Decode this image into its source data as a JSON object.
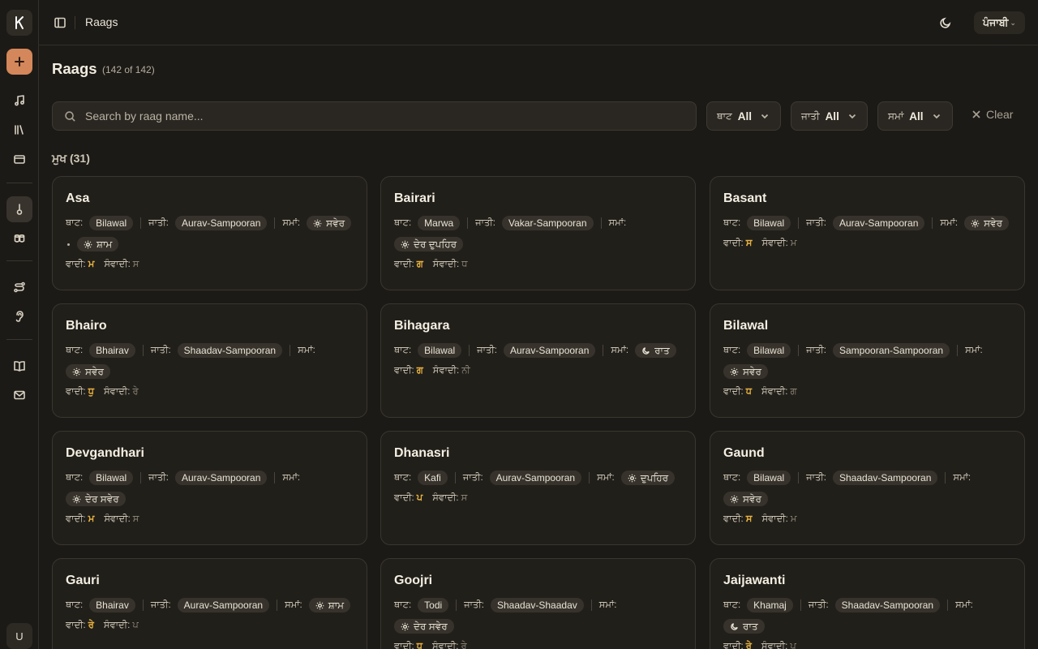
{
  "app": {
    "logo_letter": "K",
    "avatar_letter": "U"
  },
  "header": {
    "breadcrumb": "Raags",
    "language": "ਪੰਜਾਬੀ"
  },
  "page": {
    "title": "Raags",
    "count": "(142 of 142)"
  },
  "search": {
    "placeholder": "Search by raag name..."
  },
  "filters": [
    {
      "label": "ਥਾਟ",
      "value": "All"
    },
    {
      "label": "ਜਾਤੀ",
      "value": "All"
    },
    {
      "label": "ਸਮਾਂ",
      "value": "All"
    }
  ],
  "clear_label": "Clear",
  "section": {
    "label": "ਮੁਖ (31)"
  },
  "field_labels": {
    "thaat": "ਥਾਟ:",
    "jaati": "ਜਾਤੀ:",
    "samay": "ਸਮਾਂ:",
    "vadi": "ਵਾਦੀ:",
    "samvadi": "ਸੰਵਾਦੀ:"
  },
  "raags": [
    {
      "name": "Asa",
      "thaat": "Bilawal",
      "jaati": "Aurav-Sampooran",
      "samay": [
        "ਸਵੇਰ",
        "ਸ਼ਾਮ"
      ],
      "samay_icons": [
        "sun",
        "sun"
      ],
      "vadi": "ਮ",
      "samvadi": "ਸ"
    },
    {
      "name": "Bairari",
      "thaat": "Marwa",
      "jaati": "Vakar-Sampooran",
      "samay": [
        "ਦੇਰ ਦੁਪਹਿਰ"
      ],
      "samay_icons": [
        "sun"
      ],
      "vadi": "ਗ",
      "samvadi": "ਧ"
    },
    {
      "name": "Basant",
      "thaat": "Bilawal",
      "jaati": "Aurav-Sampooran",
      "samay": [
        "ਸਵੇਰ"
      ],
      "samay_icons": [
        "sun"
      ],
      "vadi": "ਸ",
      "samvadi": "ਮ"
    },
    {
      "name": "Bhairo",
      "thaat": "Bhairav",
      "jaati": "Shaadav-Sampooran",
      "samay": [
        "ਸਵੇਰ"
      ],
      "samay_icons": [
        "sun"
      ],
      "vadi": "ਧੁ",
      "samvadi": "ਰੇ"
    },
    {
      "name": "Bihagara",
      "thaat": "Bilawal",
      "jaati": "Aurav-Sampooran",
      "samay": [
        "ਰਾਤ"
      ],
      "samay_icons": [
        "moon"
      ],
      "vadi": "ਗ",
      "samvadi": "ਨੀ"
    },
    {
      "name": "Bilawal",
      "thaat": "Bilawal",
      "jaati": "Sampooran-Sampooran",
      "samay": [
        "ਸਵੇਰ"
      ],
      "samay_icons": [
        "sun"
      ],
      "vadi": "ਧ",
      "samvadi": "ਗ"
    },
    {
      "name": "Devgandhari",
      "thaat": "Bilawal",
      "jaati": "Aurav-Sampooran",
      "samay": [
        "ਦੇਰ ਸਵੇਰ"
      ],
      "samay_icons": [
        "sun"
      ],
      "vadi": "ਮ",
      "samvadi": "ਸ"
    },
    {
      "name": "Dhanasri",
      "thaat": "Kafi",
      "jaati": "Aurav-Sampooran",
      "samay": [
        "ਦੁਪਹਿਰ"
      ],
      "samay_icons": [
        "sun"
      ],
      "vadi": "ਪ",
      "samvadi": "ਸ"
    },
    {
      "name": "Gaund",
      "thaat": "Bilawal",
      "jaati": "Shaadav-Sampooran",
      "samay": [
        "ਸਵੇਰ"
      ],
      "samay_icons": [
        "sun"
      ],
      "vadi": "ਸ",
      "samvadi": "ਮ"
    },
    {
      "name": "Gauri",
      "thaat": "Bhairav",
      "jaati": "Aurav-Sampooran",
      "samay": [
        "ਸ਼ਾਮ"
      ],
      "samay_icons": [
        "sun"
      ],
      "vadi": "ਰੇ",
      "samvadi": "ਪ"
    },
    {
      "name": "Goojri",
      "thaat": "Todi",
      "jaati": "Shaadav-Shaadav",
      "samay": [
        "ਦੇਰ ਸਵੇਰ"
      ],
      "samay_icons": [
        "sun"
      ],
      "vadi": "ਧੁ",
      "samvadi": "ਰੇ"
    },
    {
      "name": "Jaijawanti",
      "thaat": "Khamaj",
      "jaati": "Shaadav-Sampooran",
      "samay": [
        "ਰਾਤ"
      ],
      "samay_icons": [
        "moon"
      ],
      "vadi": "ਰੇ",
      "samvadi": "ਪ"
    }
  ]
}
